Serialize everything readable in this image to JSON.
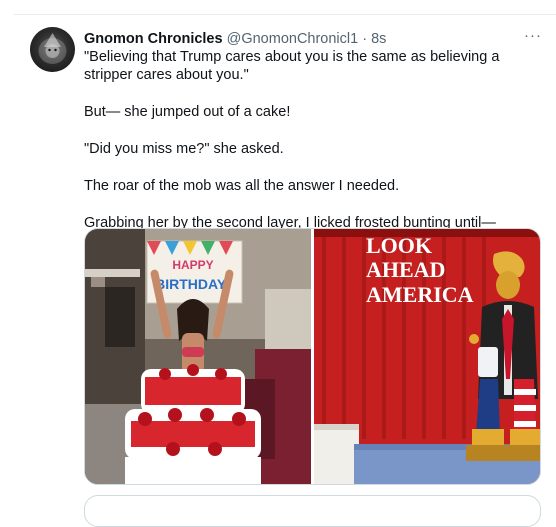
{
  "tweet": {
    "display_name": "Gnomon Chronicles",
    "handle": "@GnomonChronicl1",
    "separator": "·",
    "time": "8s",
    "more_icon": "···",
    "paragraphs": [
      "\"Believing that Trump cares about you is the same as believing a stripper cares about you.\"",
      "But— she jumped out of a cake!",
      "\"Did you miss me?\" she asked.",
      "The roar of the mob was all the answer I needed.",
      "Grabbing her by the second layer, I licked frosted bunting until—"
    ]
  },
  "media": {
    "left_image": {
      "sign_line1": "HAPPY",
      "sign_line2": "BIRTHDAY!"
    },
    "right_image": {
      "banner_line1": "LOOK",
      "banner_line2": "AHEAD",
      "banner_line3": "AMERICA"
    }
  }
}
